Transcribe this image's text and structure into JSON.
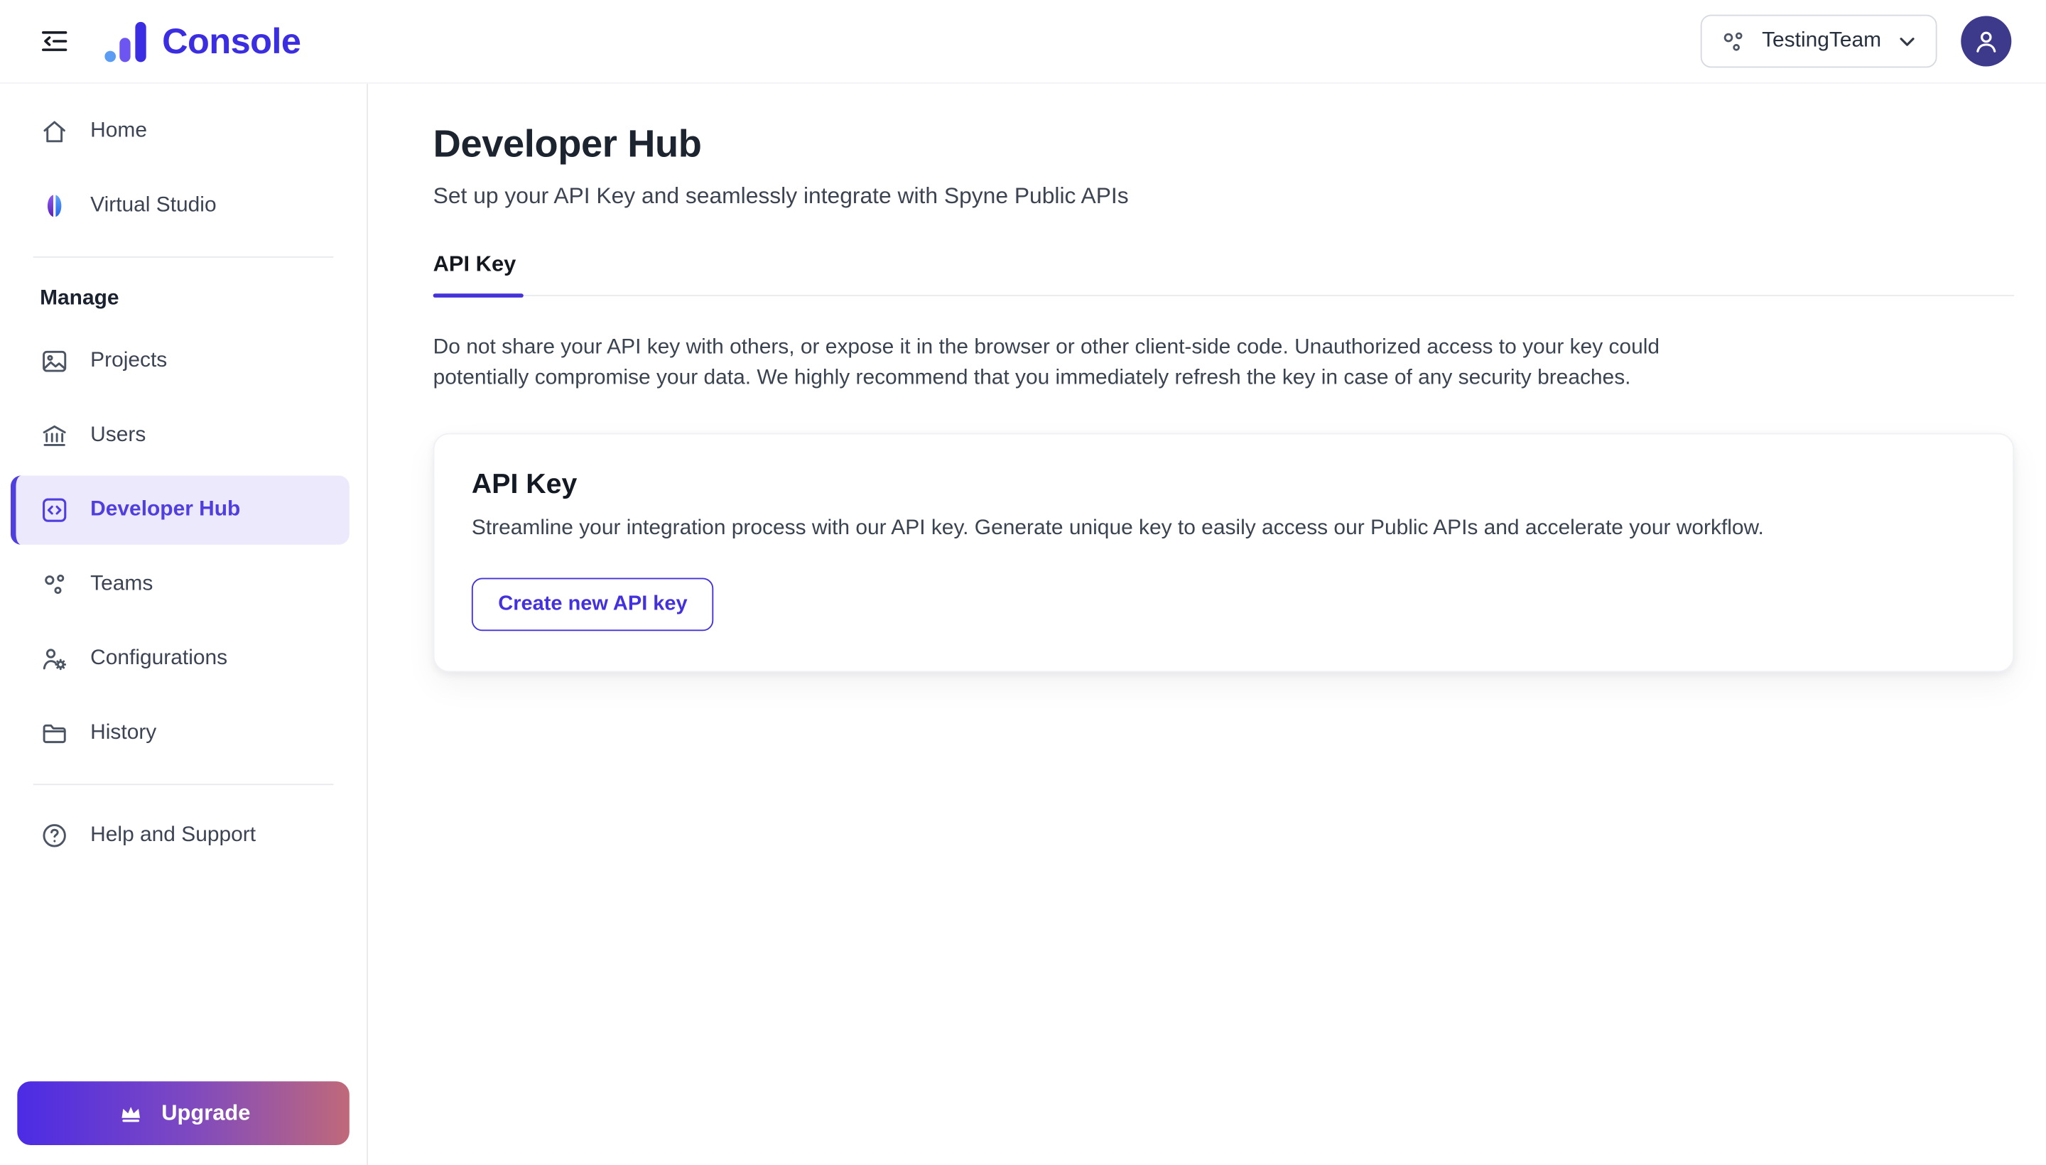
{
  "header": {
    "app_name": "Console",
    "team_selector": {
      "label": "TestingTeam"
    }
  },
  "sidebar": {
    "items": [
      {
        "label": "Home"
      },
      {
        "label": "Virtual Studio"
      }
    ],
    "section_label": "Manage",
    "manage_items": [
      {
        "label": "Projects"
      },
      {
        "label": "Users"
      },
      {
        "label": "Developer Hub",
        "active": true
      },
      {
        "label": "Teams"
      },
      {
        "label": "Configurations"
      },
      {
        "label": "History"
      }
    ],
    "help_label": "Help and Support",
    "upgrade_label": "Upgrade"
  },
  "main": {
    "page_title": "Developer Hub",
    "page_subtitle": "Set up your API Key and seamlessly integrate with Spyne Public APIs",
    "tab_label": "API Key",
    "warning_text": "Do not share your API key with others, or expose it in the browser or other client-side code. Unauthorized access to your key could potentially compromise your data. We highly recommend that you immediately refresh the key in case of any security breaches.",
    "card": {
      "title": "API Key",
      "description": "Streamline your integration process with our API key. Generate unique key to easily access our Public APIs and accelerate your workflow.",
      "button_label": "Create new API key"
    }
  },
  "colors": {
    "brand": "#3B2EE2",
    "accent": "#4433D9",
    "active_item_bg": "#EDE9FC",
    "avatar_bg": "#3D3A8C",
    "upgrade_gradient_start": "#4B2BE5",
    "upgrade_gradient_end": "#C0697A"
  }
}
